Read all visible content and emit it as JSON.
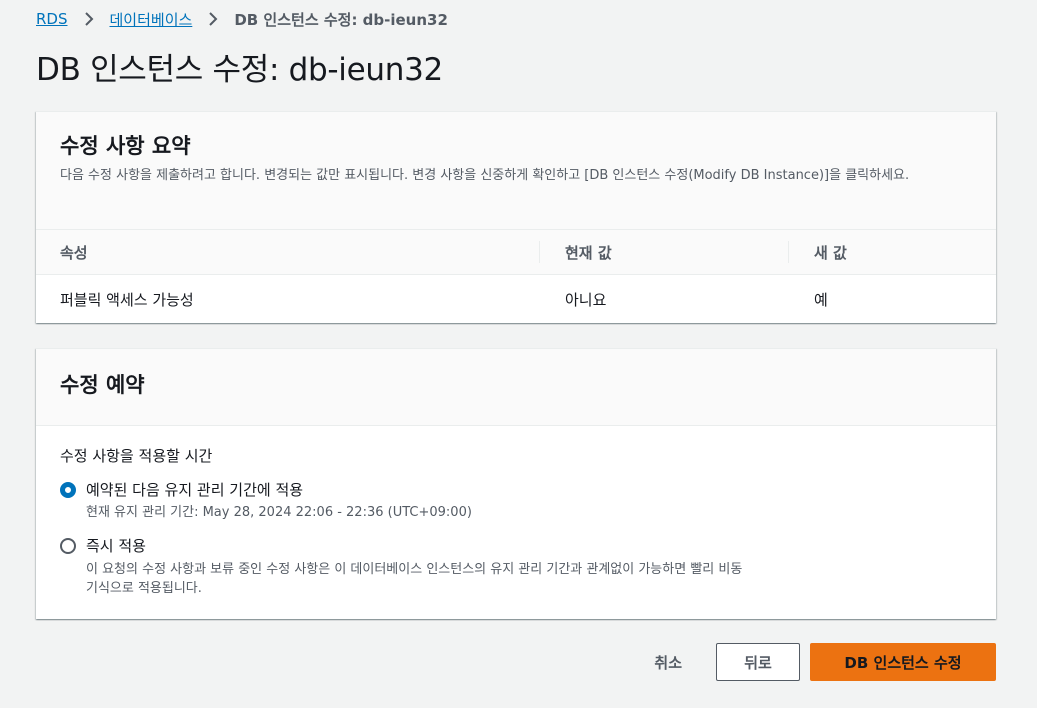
{
  "breadcrumb": {
    "items": [
      "RDS",
      "데이터베이스"
    ],
    "current": "DB 인스턴스 수정: db-ieun32"
  },
  "page_title": "DB 인스턴스 수정: db-ieun32",
  "summary": {
    "title": "수정 사항 요약",
    "description": "다음 수정 사항을 제출하려고 합니다. 변경되는 값만 표시됩니다. 변경 사항을 신중하게 확인하고 [DB 인스턴스 수정(Modify DB Instance)]을 클릭하세요.",
    "columns": [
      "속성",
      "현재 값",
      "새 값"
    ],
    "rows": [
      {
        "attribute": "퍼블릭 액세스 가능성",
        "current": "아니요",
        "new": "예"
      }
    ]
  },
  "schedule": {
    "title": "수정 예약",
    "label": "수정 사항을 적용할 시간",
    "options": [
      {
        "label": "예약된 다음 유지 관리 기간에 적용",
        "description": "현재 유지 관리 기간: May 28, 2024 22:06 - 22:36 (UTC+09:00)",
        "selected": true
      },
      {
        "label": "즉시 적용",
        "description": "이 요청의 수정 사항과 보류 중인 수정 사항은 이 데이터베이스 인스턴스의 유지 관리 기간과 관계없이 가능하면 빨리 비동기식으로 적용됩니다.",
        "selected": false
      }
    ]
  },
  "footer": {
    "cancel": "취소",
    "back": "뒤로",
    "submit": "DB 인스턴스 수정"
  },
  "colors": {
    "link": "#0073bb",
    "primary": "#ec7211",
    "background": "#f2f3f3"
  }
}
